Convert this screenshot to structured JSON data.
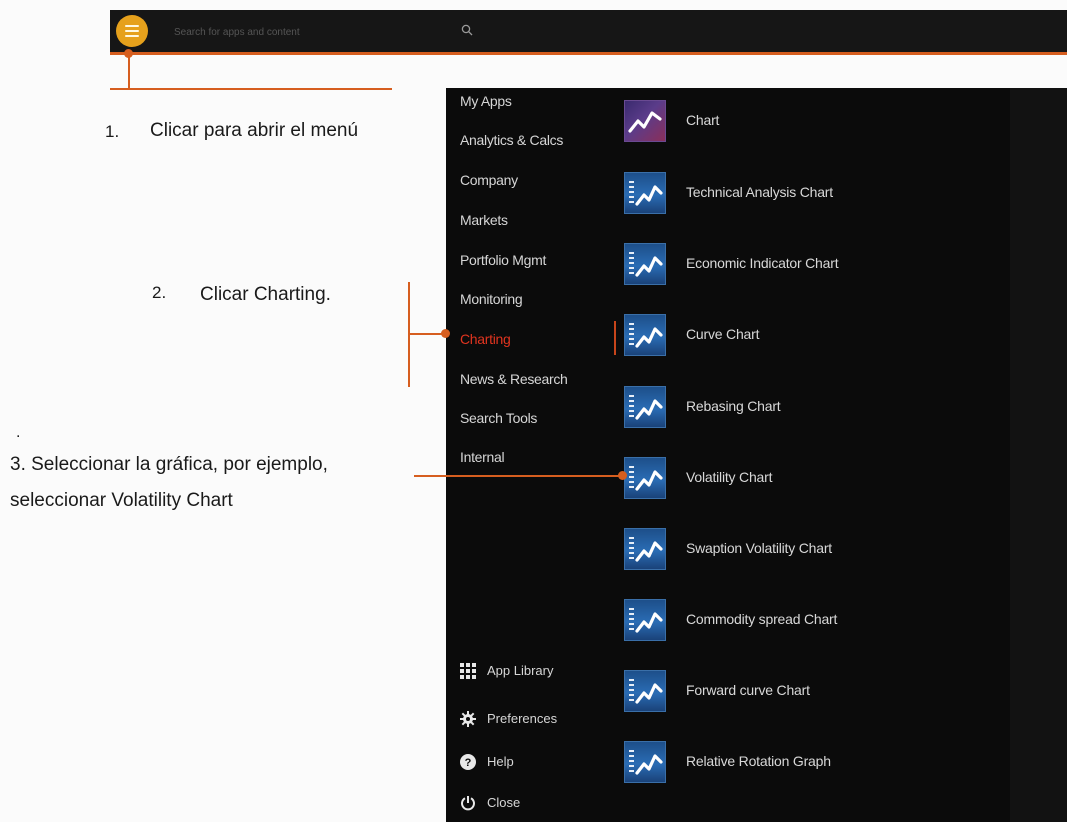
{
  "topbar": {
    "search_placeholder": "Search for apps and content",
    "colors": {
      "bar": "#161616",
      "accent": "#d65e1f",
      "app_button": "#e6a11c"
    },
    "icons": {
      "menu_button": "hamburger-menu-icon",
      "search": "search-icon"
    }
  },
  "menu": {
    "categories": [
      {
        "label": "My Apps",
        "active": false
      },
      {
        "label": "Analytics & Calcs",
        "active": false
      },
      {
        "label": "Company",
        "active": false
      },
      {
        "label": "Markets",
        "active": false
      },
      {
        "label": "Portfolio Mgmt",
        "active": false
      },
      {
        "label": "Monitoring",
        "active": false
      },
      {
        "label": "Charting",
        "active": true
      },
      {
        "label": "News & Research",
        "active": false
      },
      {
        "label": "Search Tools",
        "active": false
      },
      {
        "label": "Internal",
        "active": false
      }
    ],
    "apps": [
      {
        "label": "Chart",
        "icon": "chart-app-icon"
      },
      {
        "label": "Technical Analysis Chart",
        "icon": "chart-app-icon"
      },
      {
        "label": "Economic Indicator Chart",
        "icon": "chart-app-icon"
      },
      {
        "label": "Curve Chart",
        "icon": "chart-app-icon"
      },
      {
        "label": "Rebasing Chart",
        "icon": "chart-app-icon"
      },
      {
        "label": "Volatility Chart",
        "icon": "chart-app-icon"
      },
      {
        "label": "Swaption Volatility Chart",
        "icon": "chart-app-icon"
      },
      {
        "label": "Commodity spread Chart",
        "icon": "chart-app-icon"
      },
      {
        "label": "Forward curve Chart",
        "icon": "chart-app-icon"
      },
      {
        "label": "Relative Rotation Graph",
        "icon": "chart-app-icon"
      }
    ],
    "bottom": [
      {
        "label": "App Library",
        "icon": "grid-icon"
      },
      {
        "label": "Preferences",
        "icon": "gear-icon"
      },
      {
        "label": "Help",
        "icon": "help-icon"
      },
      {
        "label": "Close",
        "icon": "power-icon"
      }
    ],
    "colors": {
      "panel": "#0b0b0b",
      "text": "#d6d6d6",
      "active_text": "#e0341f"
    }
  },
  "annotations": {
    "step1": {
      "number": "1.",
      "text": "Clicar para abrir el menú"
    },
    "step2": {
      "number": "2.",
      "text": "Clicar Charting."
    },
    "step3": {
      "dot": ".",
      "line1": "3. Seleccionar la gráfica, por ejemplo,",
      "line2": "seleccionar Volatility Chart"
    },
    "callout_color": "#d65e1f"
  }
}
